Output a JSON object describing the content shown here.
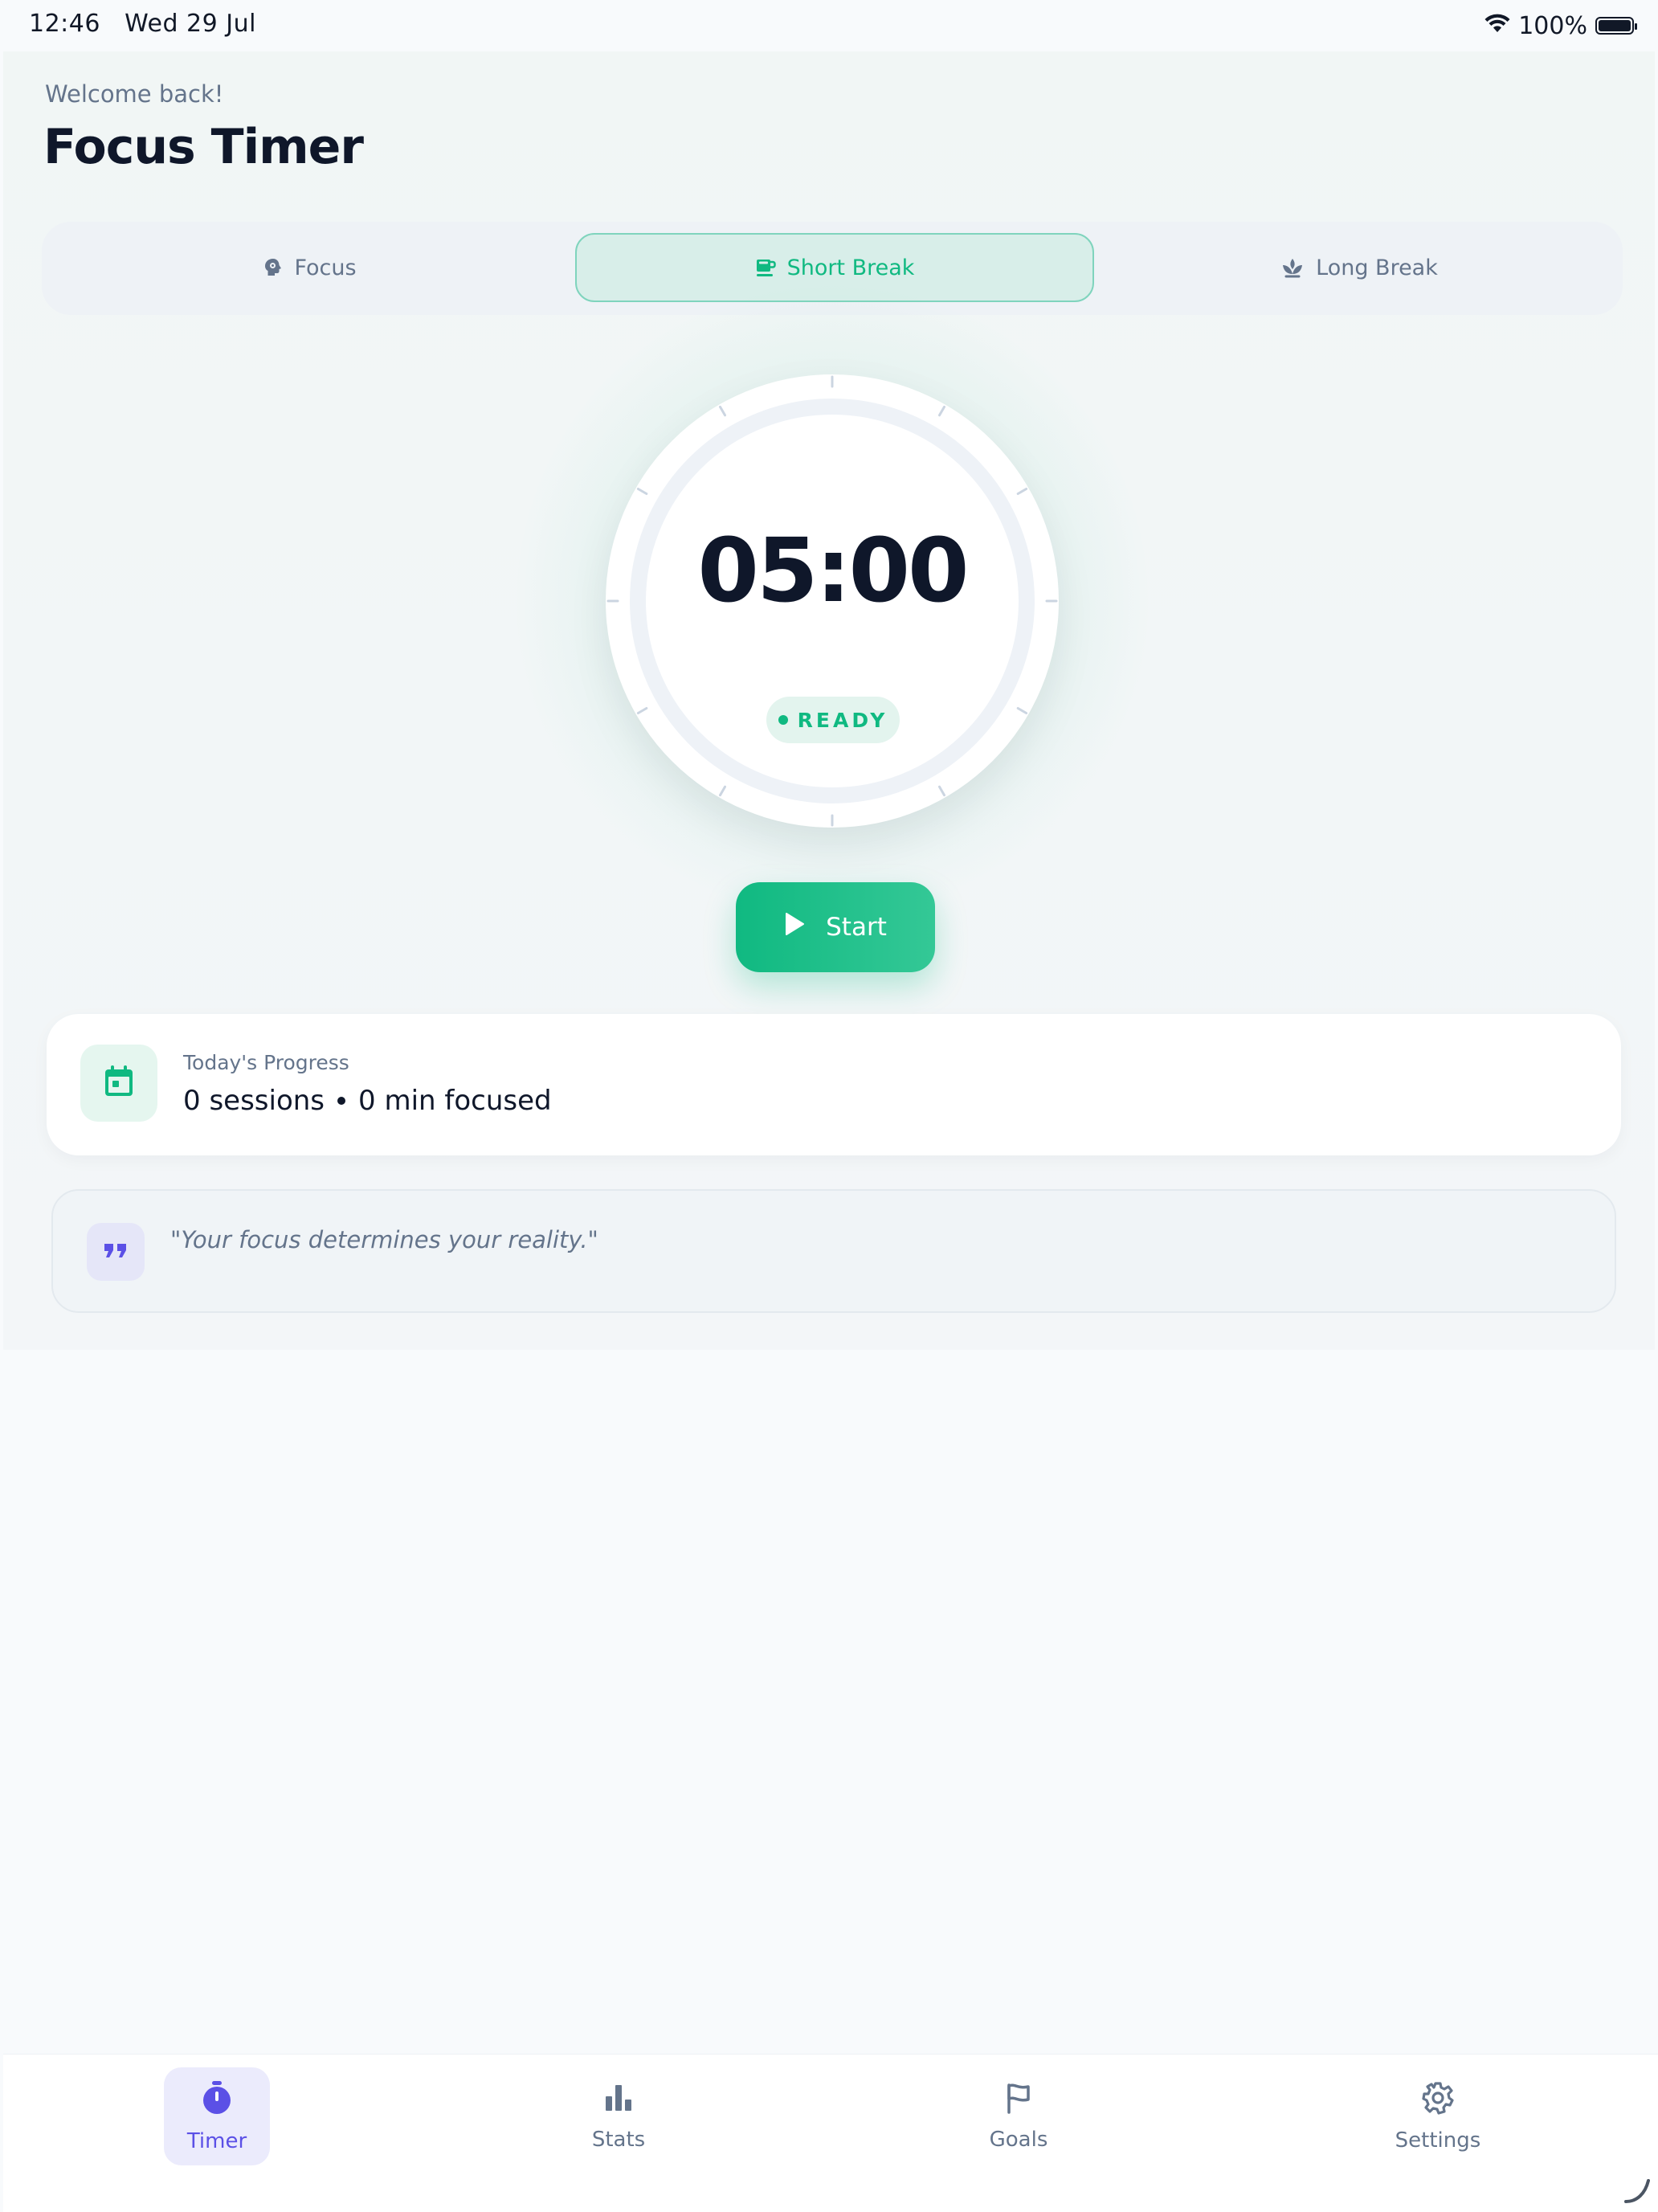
{
  "status_bar": {
    "time": "12:46",
    "date": "Wed 29 Jul",
    "battery": "100%",
    "icons": [
      "wifi-icon",
      "battery-icon"
    ]
  },
  "header": {
    "welcome": "Welcome back!",
    "title": "Focus Timer"
  },
  "modes": {
    "selected": "Short Break",
    "items": [
      {
        "label": "Focus",
        "icon": "brain-icon"
      },
      {
        "label": "Short Break",
        "icon": "coffee-cup-icon"
      },
      {
        "label": "Long Break",
        "icon": "lotus-icon"
      }
    ]
  },
  "timer": {
    "time": "05:00",
    "status": "READY"
  },
  "start_button": {
    "label": "Start",
    "icon": "play-icon"
  },
  "progress": {
    "label": "Today's Progress",
    "sessions": "0 sessions",
    "minutes": "0 min focused",
    "icon": "calendar-icon"
  },
  "quote": {
    "text": "\"Your focus determines your reality.\"",
    "icon": "quote-icon"
  },
  "tabbar": {
    "active": "Timer",
    "items": [
      {
        "label": "Timer",
        "icon": "stopwatch-icon"
      },
      {
        "label": "Stats",
        "icon": "bar-chart-icon"
      },
      {
        "label": "Goals",
        "icon": "flag-icon"
      },
      {
        "label": "Settings",
        "icon": "gear-icon"
      }
    ]
  },
  "colors": {
    "accent_green": "#10b981",
    "accent_indigo": "#5b50e6",
    "text_dark": "#0f172a",
    "text_muted": "#64748b"
  }
}
